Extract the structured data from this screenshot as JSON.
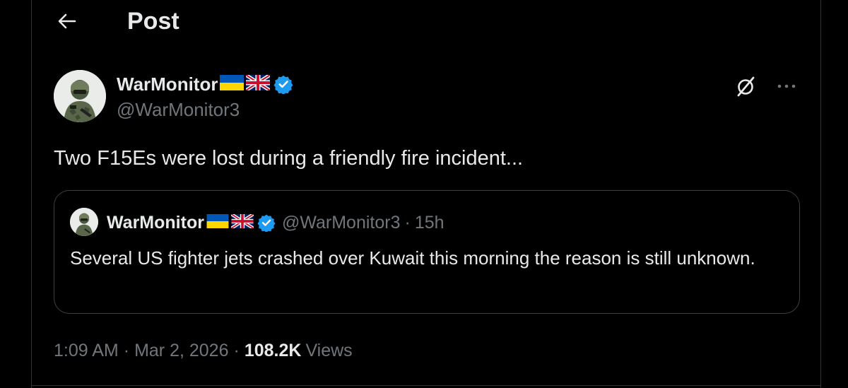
{
  "header": {
    "title": "Post",
    "back_icon": "arrow-left-icon"
  },
  "post": {
    "author_name": "WarMonitor",
    "author_handle": "@WarMonitor3",
    "flags": [
      "ukraine-flag",
      "uk-flag"
    ],
    "verified_badge_color": "#1d9bf0",
    "text": "Two F15Es were lost during a friendly fire incident...",
    "time": "1:09 AM",
    "date": "Mar 2, 2026",
    "views_count": "108.2K",
    "views_label": "Views",
    "actions": [
      "grok-icon",
      "more-icon"
    ]
  },
  "quote": {
    "author_name": "WarMonitor",
    "author_handle": "@WarMonitor3",
    "separator": "·",
    "time": "15h",
    "text": "Several US fighter jets crashed over Kuwait this morning the reason is still unknown."
  },
  "meta": {
    "separator": "·"
  },
  "colors": {
    "background": "#000000",
    "primary_text": "#e7e9ea",
    "secondary_text": "#71767b",
    "border": "#2f3336",
    "verified": "#1d9bf0",
    "ukraine_blue": "#0057b7",
    "ukraine_yellow": "#ffd700"
  }
}
